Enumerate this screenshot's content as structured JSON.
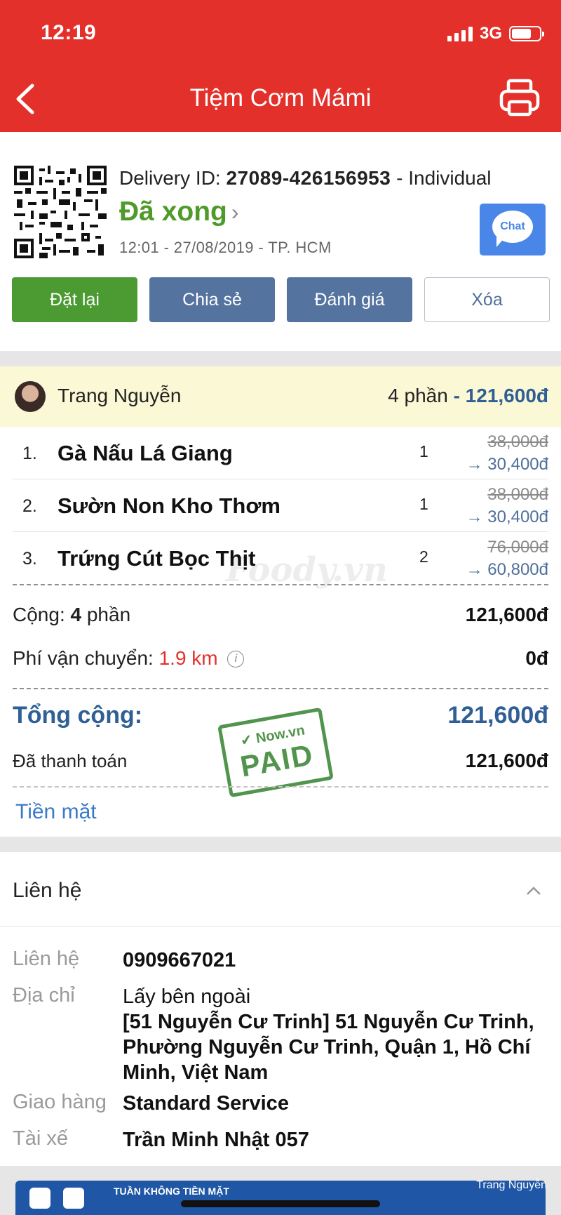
{
  "status_bar": {
    "time": "12:19",
    "network": "3G"
  },
  "header": {
    "title": "Tiệm Cơm Mámi",
    "back_icon": "chevron-left-icon",
    "print_icon": "printer-icon"
  },
  "order": {
    "delivery_label": "Delivery ID:",
    "delivery_id": "27089-426156953",
    "delivery_type": "- Individual",
    "status": "Đã xong",
    "meta": "12:01 - 27/08/2019 - TP. HCM",
    "chat_label": "Chat",
    "actions": {
      "reorder": "Đặt lại",
      "share": "Chia sẻ",
      "rate": "Đánh giá",
      "delete": "Xóa"
    }
  },
  "buyer": {
    "name": "Trang Nguyễn",
    "portions": "4 phần",
    "total": "- 121,600đ"
  },
  "items": [
    {
      "index": "1.",
      "name": "Gà Nấu Lá Giang",
      "qty": "1",
      "old_price": "38,000đ",
      "new_price": "→ 30,400đ"
    },
    {
      "index": "2.",
      "name": "Sườn Non Kho Thơm",
      "qty": "1",
      "old_price": "38,000đ",
      "new_price": "→ 30,400đ"
    },
    {
      "index": "3.",
      "name": "Trứng Cút Bọc Thịt",
      "qty": "2",
      "old_price": "76,000đ",
      "new_price": "→ 60,800đ"
    }
  ],
  "totals": {
    "subtotal_label": "Cộng:",
    "subtotal_count": "4",
    "subtotal_unit": "phần",
    "subtotal_value": "121,600đ",
    "shipping_label": "Phí vận chuyển:",
    "shipping_distance": "1.9 km",
    "shipping_value": "0đ",
    "grand_label": "Tổng cộng:",
    "grand_value": "121,600đ",
    "paid_label": "Đã thanh toán",
    "paid_value": "121,600đ",
    "payment_method": "Tiền mặt"
  },
  "watermark": "Foody.vn",
  "stamp": {
    "top": "Now.vn",
    "bottom": "PAID"
  },
  "contact": {
    "title": "Liên hệ",
    "rows": {
      "phone_label": "Liên hệ",
      "phone": "0909667021",
      "address_label": "Địa chỉ",
      "address_line1": "Lấy bên ngoài",
      "address_line2": "[51 Nguyễn Cư Trinh] 51 Nguyễn Cư Trinh, Phường Nguyễn Cư Trinh, Quận 1, Hồ Chí Minh, Việt Nam",
      "service_label": "Giao hàng",
      "service": "Standard Service",
      "driver_label": "Tài xế",
      "driver": "Trần Minh Nhật 057"
    }
  },
  "banner": {
    "promo": "TUẦN KHÔNG TIỀN MẶT",
    "brand": "Trang Nguyễn"
  },
  "colors": {
    "header": "#e4302a",
    "status_done": "#4e9a2a",
    "accent_blue": "#2f5f95",
    "reorder": "#4c9a32",
    "secondary": "#55739f"
  }
}
